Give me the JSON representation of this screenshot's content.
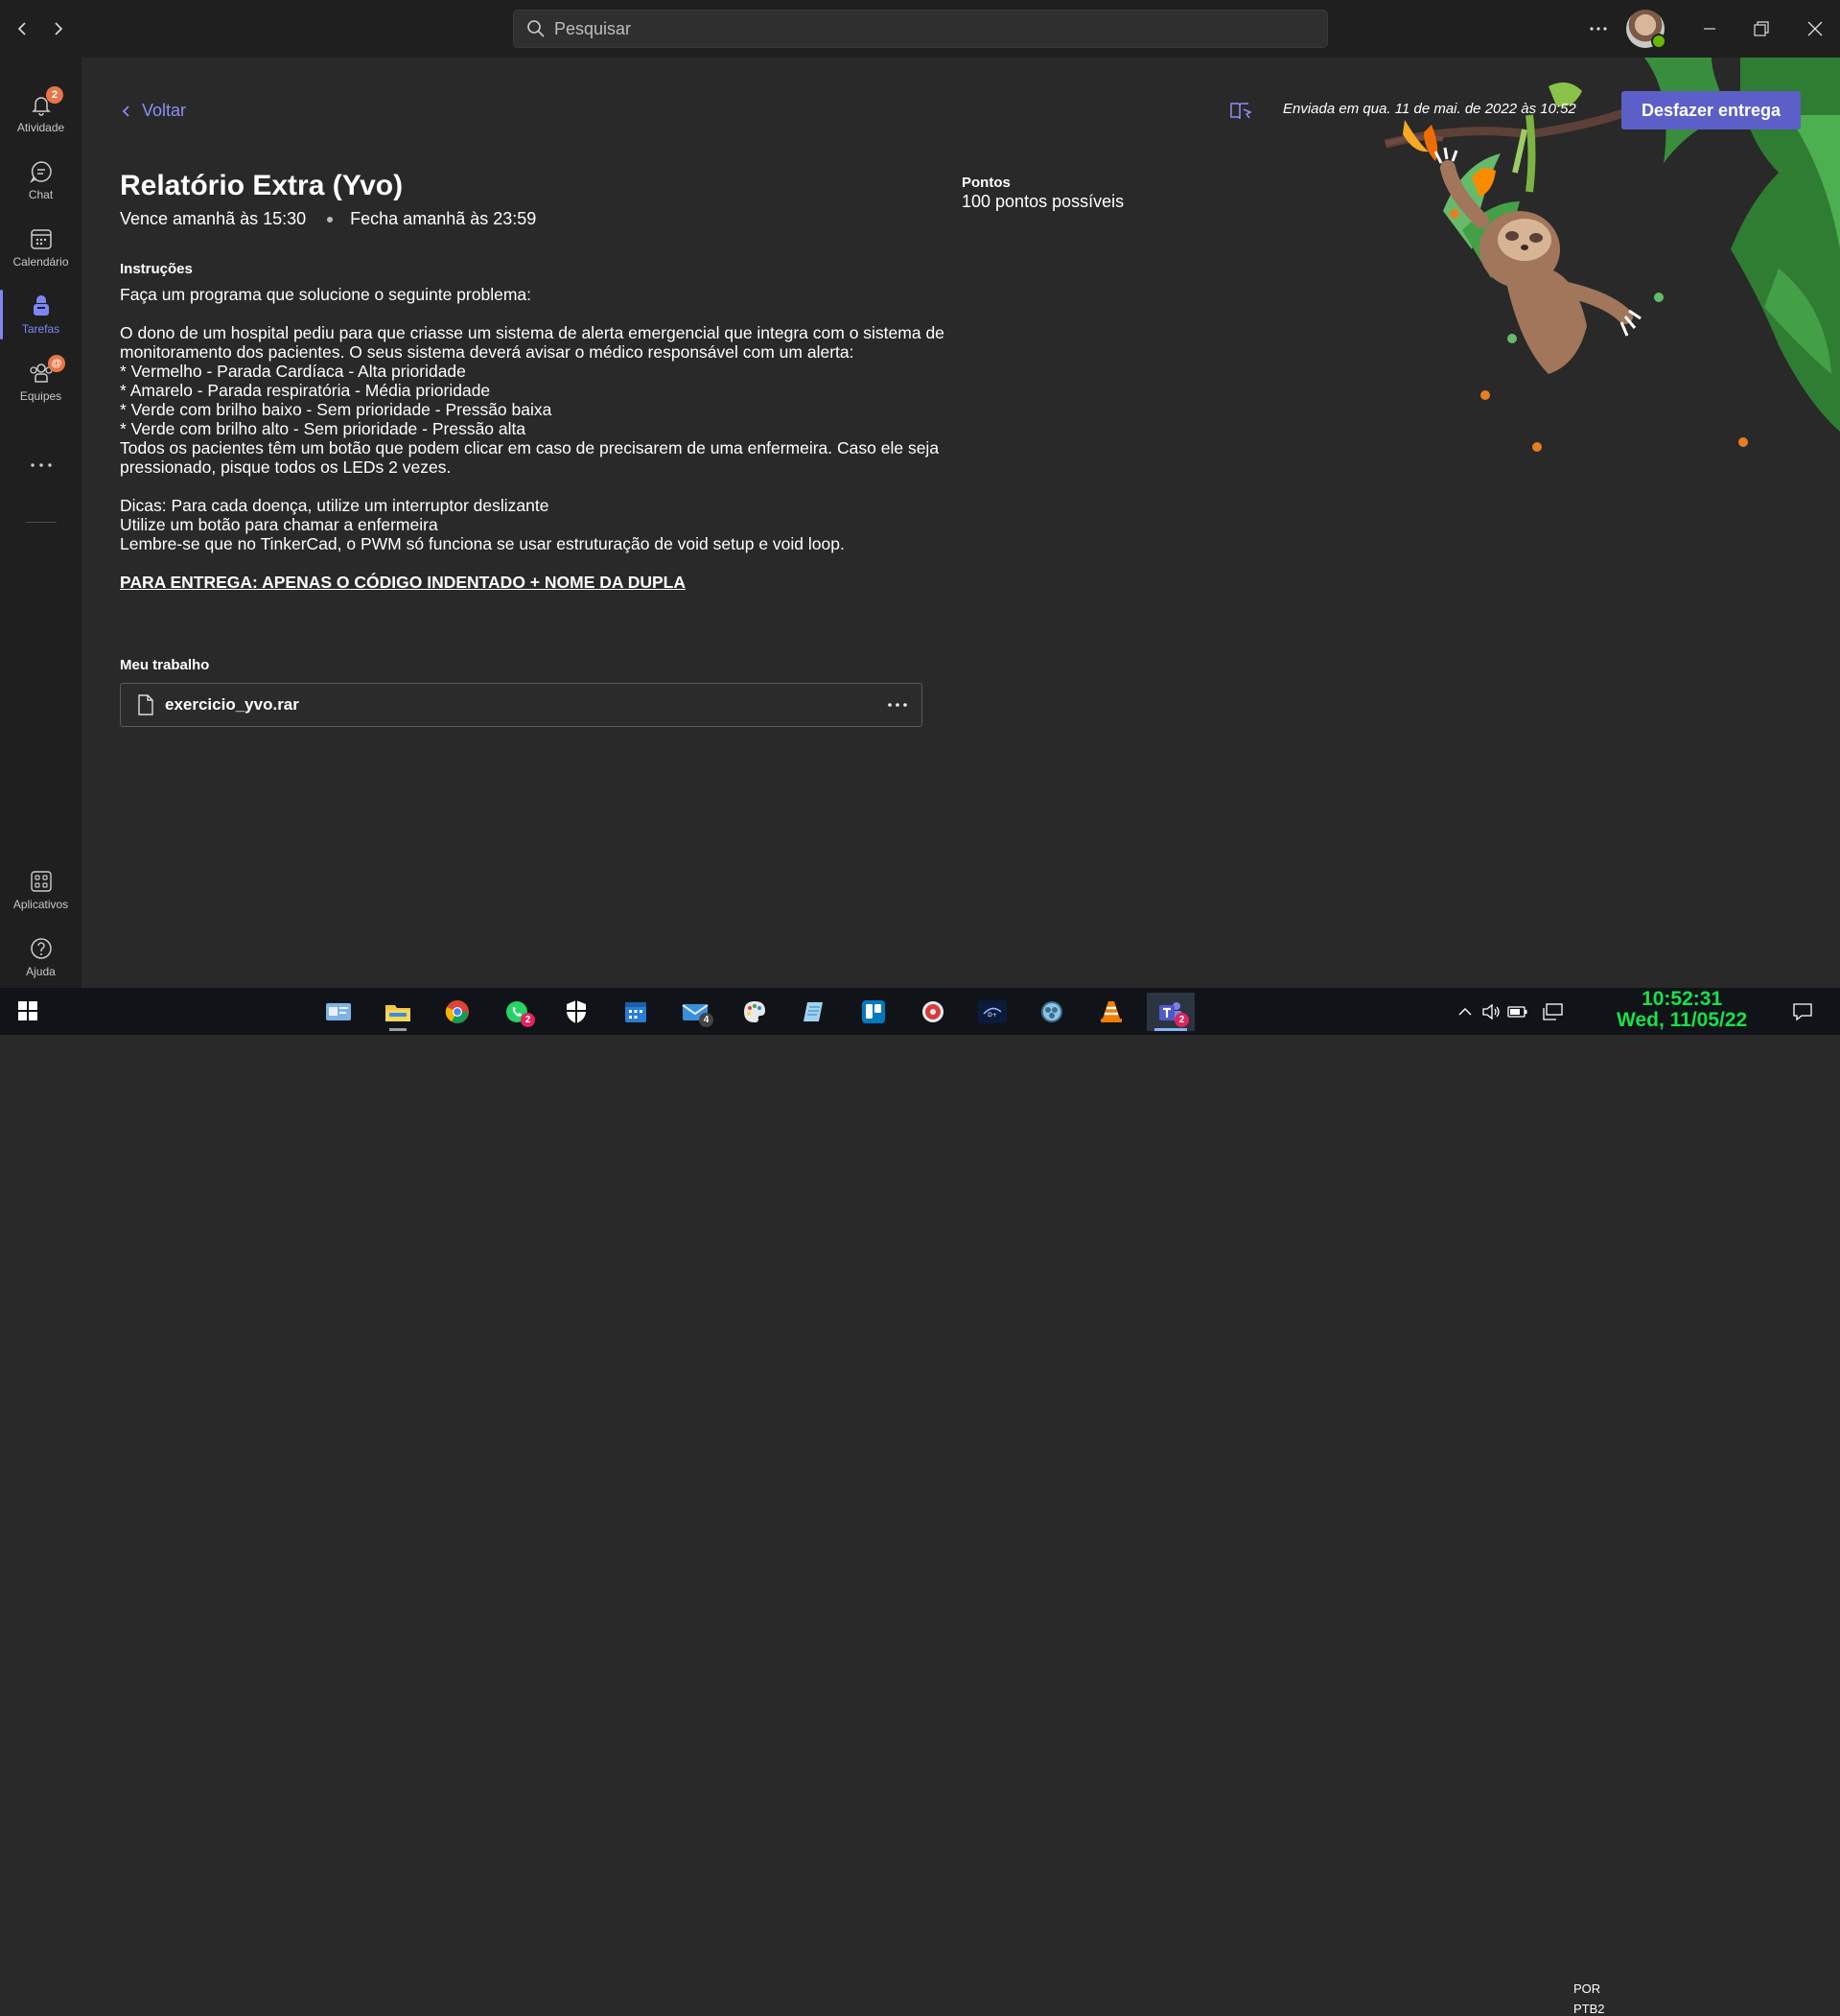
{
  "search": {
    "placeholder": "Pesquisar"
  },
  "rail": {
    "items": [
      {
        "label": "Atividade",
        "badge": "2"
      },
      {
        "label": "Chat"
      },
      {
        "label": "Calendário"
      },
      {
        "label": "Tarefas",
        "active": true
      },
      {
        "label": "Equipes",
        "badge": "@"
      }
    ],
    "bottom": [
      {
        "label": "Aplicativos"
      },
      {
        "label": "Ajuda"
      }
    ]
  },
  "assignment": {
    "back_label": "Voltar",
    "title": "Relatório Extra (Yvo)",
    "due": "Vence amanhã às 15:30",
    "closes": "Fecha amanhã às 23:59",
    "instructions_label": "Instruções",
    "instructions": [
      "Faça um programa que solucione o seguinte problema:",
      "O dono de um hospital pediu para que criasse um sistema de alerta emergencial que integra com o sistema de monitoramento dos pacientes. O seus sistema deverá avisar o médico responsável com um alerta:",
      "* Vermelho - Parada Cardíaca - Alta prioridade",
      "* Amarelo - Parada respiratória - Média prioridade",
      "* Verde com brilho baixo - Sem prioridade - Pressão baixa",
      "* Verde com brilho alto - Sem prioridade - Pressão alta",
      "Todos os pacientes têm um botão que podem clicar em caso de precisarem de uma enfermeira. Caso ele seja pressionado, pisque todos os LEDs 2 vezes.",
      "Dicas: Para cada doença, utilize um interruptor deslizante",
      "Utilize um botão para chamar a enfermeira",
      "Lembre-se que no TinkerCad, o PWM só funciona se usar estruturação de void setup e void loop.",
      "PARA ENTREGA: APENAS O CÓDIGO INDENTADO + NOME DA DUPLA"
    ],
    "my_work_label": "Meu trabalho",
    "file_name": "exercicio_yvo.rar",
    "points_label": "Pontos",
    "points_value": "100 pontos possíveis",
    "sent_text": "Enviada em qua. 11 de mai. de 2022 às 10:52",
    "undo_button": "Desfazer entrega"
  },
  "taskbar": {
    "apps": [
      {
        "icon": "contacts-icon"
      },
      {
        "icon": "file-explorer-icon",
        "running": true
      },
      {
        "icon": "chrome-icon"
      },
      {
        "icon": "whatsapp-icon",
        "badge": "2"
      },
      {
        "icon": "security-shield-icon"
      },
      {
        "icon": "calendar-app-icon"
      },
      {
        "icon": "mail-icon",
        "badge": "4"
      },
      {
        "icon": "paint-icon"
      },
      {
        "icon": "notes-icon"
      },
      {
        "icon": "trello-icon"
      },
      {
        "icon": "media-player-icon"
      },
      {
        "icon": "disney-plus-icon"
      },
      {
        "icon": "obs-icon"
      },
      {
        "icon": "vlc-icon"
      },
      {
        "icon": "teams-icon",
        "badge": "2",
        "active": true
      }
    ],
    "lang1": "POR",
    "lang2": "PTB2",
    "time": "10:52:31",
    "date": "Wed, 11/05/22"
  },
  "colors": {
    "accent": "#5b5fc7",
    "rail_active": "#7f85f5",
    "background": "#292929",
    "clock": "#19e04a"
  }
}
